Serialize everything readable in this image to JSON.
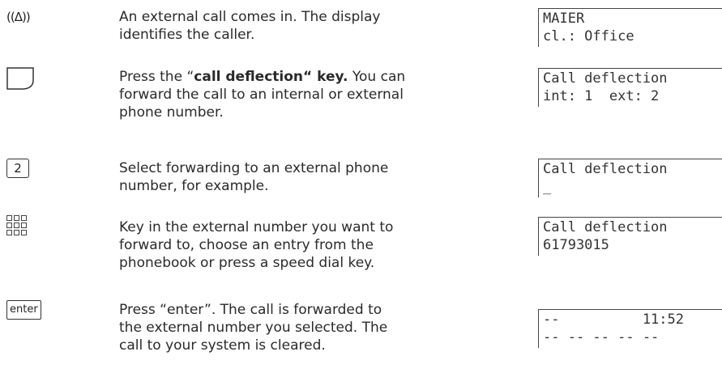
{
  "steps": [
    {
      "icon": "ringing-icon",
      "icon_text": "((Δ))",
      "text": "An external call comes in. The display identifies the caller.",
      "display": [
        "MAIER",
        "cl.: Office"
      ]
    },
    {
      "icon": "call-deflection-key-icon",
      "text_before": "Press the “",
      "text_bold": "call deflection“ key.",
      "text_after": " You can forward the call to an internal or external phone number.",
      "display": [
        "Call deflection",
        "int: 1  ext: 2"
      ]
    },
    {
      "icon": "digit-key-icon",
      "key_label": "2",
      "text": "Select forwarding to an external phone number, for example.",
      "display": [
        "Call deflection",
        "_"
      ]
    },
    {
      "icon": "keypad-icon",
      "text": "Key in the external number you want to forward to, choose an entry from the phonebook or press a speed dial key.",
      "display": [
        "Call deflection",
        "61793015"
      ]
    },
    {
      "icon": "enter-key-icon",
      "key_label": "enter",
      "text": "Press “enter”. The call is forwarded to the external number you selected. The call to your system is cleared.",
      "display": [
        "--          11:52",
        "-- -- -- -- --"
      ]
    }
  ]
}
